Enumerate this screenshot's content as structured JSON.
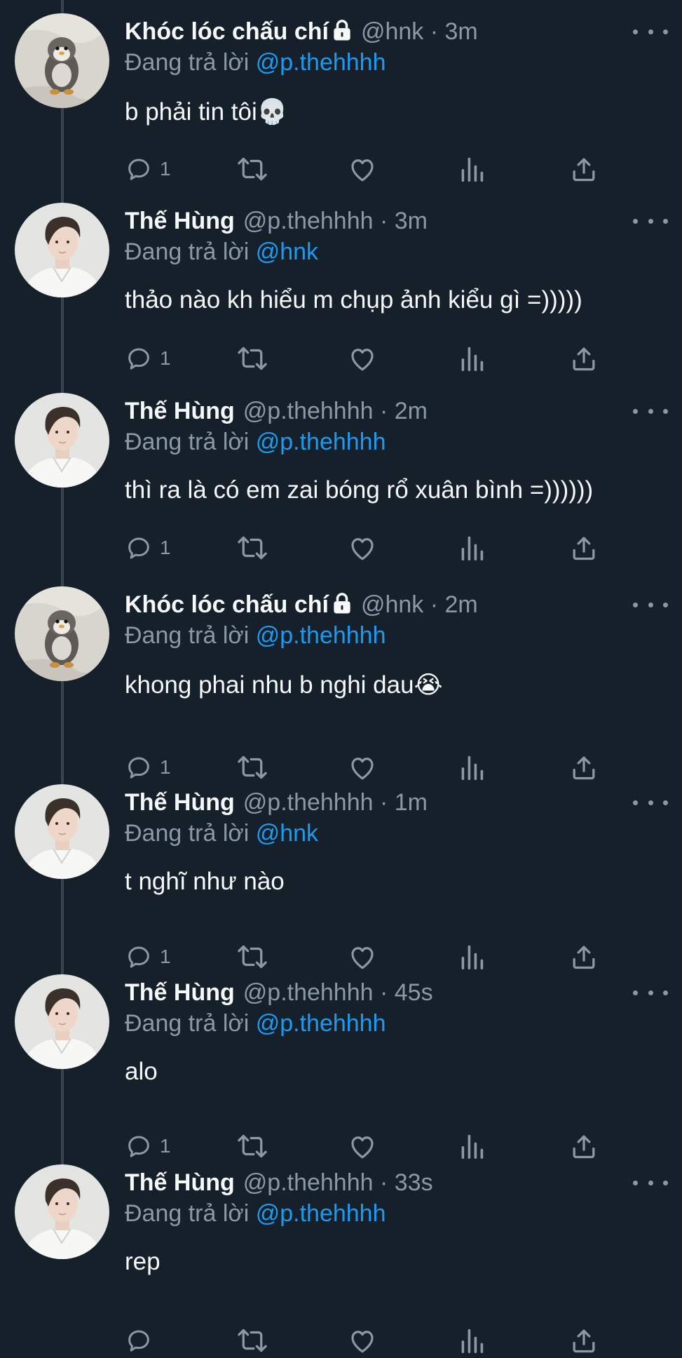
{
  "theme": {
    "background": "#15202b",
    "text": "#f7f9f9",
    "muted": "#8b98a5",
    "link": "#1d9bf0"
  },
  "tweets": [
    {
      "avatar": "penguin-plush-avatar",
      "name": "Khóc lóc chấu chí",
      "locked": true,
      "meta": "@hnk · 3m",
      "replying_prefix": "Đang trả lời",
      "replying_to": "@p.thehhhh",
      "text": "b phải tin tôi",
      "emoji": "💀",
      "reply_count": "1"
    },
    {
      "avatar": "person-avatar",
      "name": "Thế Hùng",
      "locked": false,
      "meta": "@p.thehhhh · 3m",
      "replying_prefix": "Đang trả lời",
      "replying_to": "@hnk",
      "text": "thảo nào kh hiểu m chụp ảnh kiểu gì =)))))",
      "emoji": "",
      "reply_count": "1"
    },
    {
      "avatar": "person-avatar",
      "name": "Thế Hùng",
      "locked": false,
      "meta": "@p.thehhhh · 2m",
      "replying_prefix": "Đang trả lời",
      "replying_to": "@p.thehhhh",
      "text": "thì ra là có em zai bóng rổ xuân bình =))))))",
      "emoji": "",
      "reply_count": "1"
    },
    {
      "avatar": "penguin-plush-avatar",
      "name": "Khóc lóc chấu chí",
      "locked": true,
      "meta": "@hnk · 2m",
      "replying_prefix": "Đang trả lời",
      "replying_to": "@p.thehhhh",
      "text": "khong phai nhu b nghi dau",
      "emoji": "😭",
      "reply_count": "1"
    },
    {
      "avatar": "person-avatar",
      "name": "Thế Hùng",
      "locked": false,
      "meta": "@p.thehhhh · 1m",
      "replying_prefix": "Đang trả lời",
      "replying_to": "@hnk",
      "text": "t nghĩ như nào",
      "emoji": "",
      "reply_count": "1"
    },
    {
      "avatar": "person-avatar",
      "name": "Thế Hùng",
      "locked": false,
      "meta": "@p.thehhhh · 45s",
      "replying_prefix": "Đang trả lời",
      "replying_to": "@p.thehhhh",
      "text": "alo",
      "emoji": "",
      "reply_count": "1"
    },
    {
      "avatar": "person-avatar",
      "name": "Thế Hùng",
      "locked": false,
      "meta": "@p.thehhhh · 33s",
      "replying_prefix": "Đang trả lời",
      "replying_to": "@p.thehhhh",
      "text": "rep",
      "emoji": "",
      "reply_count": ""
    }
  ]
}
